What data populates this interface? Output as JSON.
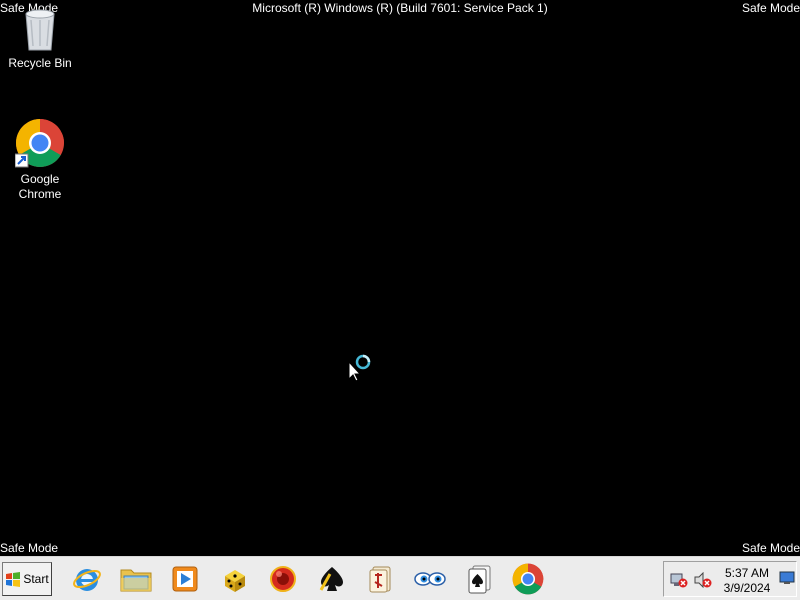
{
  "desktop": {
    "background": "#000000",
    "corner_labels": {
      "top_left": "Safe Mode",
      "top_right": "Safe Mode",
      "bottom_left": "Safe Mode",
      "bottom_right": "Safe Mode"
    },
    "build_info": "Microsoft (R) Windows (R) (Build 7601: Service Pack 1)",
    "icons": [
      {
        "label": "Recycle Bin",
        "icon": "recycle-bin-icon"
      },
      {
        "label": "Google\nChrome",
        "icon": "chrome-icon"
      }
    ]
  },
  "taskbar": {
    "start_label": "Start",
    "quick_launch": [
      "internet-explorer-icon",
      "windows-explorer-icon",
      "media-player-icon",
      "dice-game-icon",
      "red-ball-game-icon",
      "spades-game-icon",
      "mahjong-game-icon",
      "eyes-icon",
      "solitaire-icon",
      "chrome-icon"
    ],
    "tray": {
      "icons": [
        "network-disconnected-icon",
        "volume-muted-icon",
        "show-desktop-icon"
      ],
      "time": "5:37 AM",
      "date": "3/9/2024"
    }
  },
  "cursor": "busy-arrow-cursor"
}
